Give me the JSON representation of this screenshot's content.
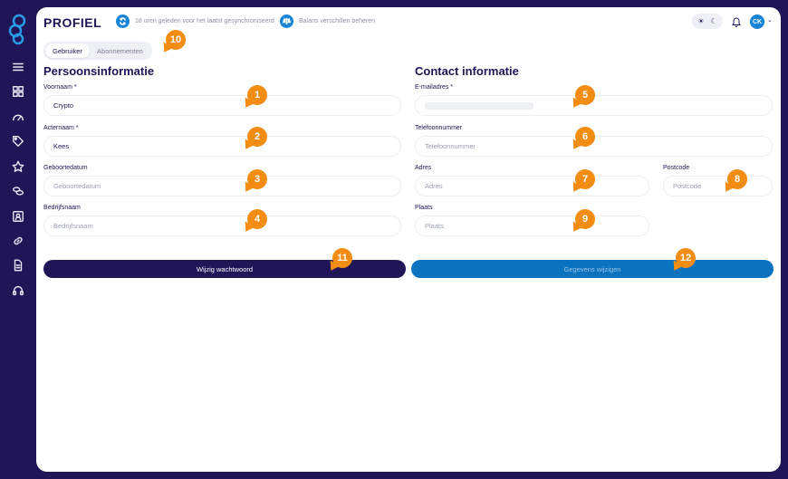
{
  "header": {
    "title": "PROFIEL",
    "sync_text": "18 uren geleden voor het laatst gesynchroniseerd",
    "balance_text": "Balans verschillen beheren",
    "avatar_initials": "CK"
  },
  "tabs": [
    {
      "label": "Gebruiker",
      "active": true
    },
    {
      "label": "Abonnementen",
      "active": false
    }
  ],
  "personal": {
    "title": "Persoonsinformatie",
    "first_name": {
      "label": "Voornaam *",
      "value": "Crypto"
    },
    "last_name": {
      "label": "Acternaam *",
      "value": "Kees"
    },
    "birthdate": {
      "label": "Geboortedatum",
      "placeholder": "Geboortedatum"
    },
    "company": {
      "label": "Bedrijfsnaam",
      "placeholder": "Bedrijfsnaam"
    },
    "password_button": "Wijzig wachtwoord"
  },
  "contact": {
    "title": "Contact informatie",
    "email": {
      "label": "E-mailadres *"
    },
    "phone": {
      "label": "Telefoonnummer",
      "placeholder": "Telefoonnummer"
    },
    "address": {
      "label": "Adres",
      "placeholder": "Adres"
    },
    "postcode": {
      "label": "Postcode",
      "placeholder": "Postcode"
    },
    "city": {
      "label": "Plaats",
      "placeholder": "Plaats"
    },
    "save_button": "Gegevens wijzigen"
  },
  "callouts": [
    "1",
    "2",
    "3",
    "4",
    "5",
    "6",
    "7",
    "8",
    "9",
    "10",
    "11",
    "12"
  ],
  "sidebar_icons": [
    "menu-icon",
    "dashboard-icon",
    "gauge-icon",
    "tag-icon",
    "star-icon",
    "coins-icon",
    "contact-card-icon",
    "link-icon",
    "document-icon",
    "support-icon"
  ],
  "colors": {
    "brand_dark": "#1f1557",
    "accent_blue": "#1784d6",
    "callout_orange": "#f28c13"
  }
}
